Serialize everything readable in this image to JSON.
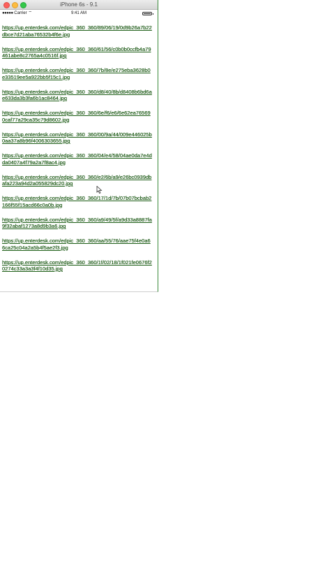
{
  "window": {
    "title": "iPhone 6s - 9.1"
  },
  "status": {
    "carrier": "Carrier",
    "clock": "9:41 AM",
    "battery_level": 1.0
  },
  "links": [
    "https://up.enterdesk.com/edpic_360_360/89/06/19/0d9b26a7b22dbce7d21aba76532b4f6e.jpg",
    "https://up.enterdesk.com/edpic_360_360/61/56/c0b0b0ccfb4a79461abe8c2765a4c0516f.jpg",
    "https://up.enterdesk.com/edpic_360_360/7b/8e/e275eba3628b0e33519ee5a922bb5f15c1.jpg",
    "https://up.enterdesk.com/edpic_360_360/d8/40/8b/d8408b6bd6ae633da3b3fa6b1ac8464.jpg",
    "https://up.enterdesk.com/edpic_360_360/6e/f6/e6/6e62ea765690caf77a29ca35c79d8602.jpg",
    "https://up.enterdesk.com/edpic_360_360/00/9a/44/009e446025b0aa37a8b96f4006303655.jpg",
    "https://up.enterdesk.com/edpic_360_360/04/e4/58/04ae0da7e4dda0407a4f79a2a7f8ac4.jpg",
    "https://up.enterdesk.com/edpic_360_360/e2/6b/a9/e26bc0939dbafa223a94d2a055829dc20.jpg",
    "https://up.enterdesk.com/edpic_360_360/17/1d/7b/07b07bcbab2166f55f15acd66c0a0b.jpg",
    "https://up.enterdesk.com/edpic_360_360/a9/49/5f/a9d33a8887fa9f32abaf1273a8d9b3a6.jpg",
    "https://up.enterdesk.com/edpic_360_360/aa/55/76/aae75f4e0a66ca25c04a2a5b4f5ae2f3.jpg",
    "https://up.enterdesk.com/edpic_360_360/1f/02/18/1f021fe0676f20274c33a3a3f4f10d35.jpg"
  ]
}
